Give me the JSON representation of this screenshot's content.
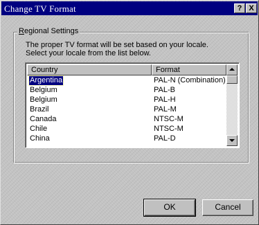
{
  "window": {
    "title": "Change TV Format",
    "help_label": "?",
    "close_label": "X"
  },
  "group": {
    "label_first": "R",
    "label_rest": "egional Settings",
    "description_line1": "The proper TV format will be set based on your locale.",
    "description_line2": "Select your locale from the list below."
  },
  "list": {
    "columns": {
      "country": "Country",
      "format": "Format"
    },
    "rows": [
      {
        "country": "Argentina",
        "format": "PAL-N (Combination)",
        "selected": true
      },
      {
        "country": "Belgium",
        "format": "PAL-B"
      },
      {
        "country": "Belgium",
        "format": "PAL-H"
      },
      {
        "country": "Brazil",
        "format": "PAL-M"
      },
      {
        "country": "Canada",
        "format": "NTSC-M"
      },
      {
        "country": "Chile",
        "format": "NTSC-M"
      },
      {
        "country": "China",
        "format": "PAL-D"
      }
    ]
  },
  "buttons": {
    "ok": "OK",
    "cancel": "Cancel"
  },
  "colors": {
    "titlebar": "#000080",
    "selection": "#000080",
    "face": "#c0c0c0"
  }
}
